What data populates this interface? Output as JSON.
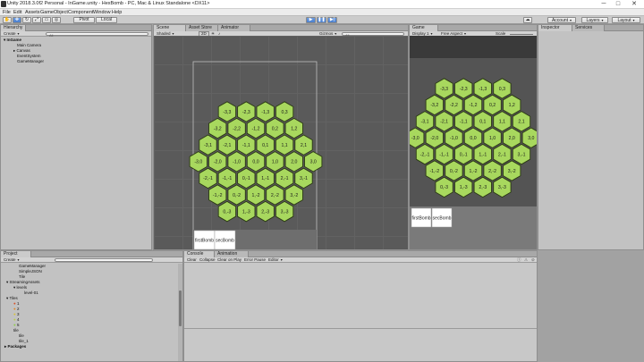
{
  "window": {
    "title": "Unity 2018.3.0f2 Personal - InGame.unity - HexBomb - PC, Mac & Linux Standalone <DX11>",
    "minimize": "─",
    "maximize": "□",
    "close": "✕"
  },
  "menu": [
    "File",
    "Edit",
    "Assets",
    "GameObject",
    "Component",
    "Window",
    "Help"
  ],
  "toolbar": {
    "pivot": "Pivot",
    "local": "Local",
    "account": "Account",
    "layers": "Layers",
    "layout": "Layout"
  },
  "hierarchy": {
    "tab": "Hierarchy",
    "create": "Create",
    "search": "All",
    "scene": "InGame",
    "items": [
      "Main Camera",
      "Canvas",
      "EventSystem",
      "GameManager"
    ]
  },
  "scene_panel": {
    "tabs": [
      "Scene",
      "Asset Store",
      "Animator"
    ],
    "shading": "Shaded",
    "mode": "2D",
    "gizmos": "Gizmos",
    "search": "All"
  },
  "game_panel": {
    "tab": "Game",
    "display": "Display 1",
    "aspect": "Free Aspect",
    "scale": "Scale"
  },
  "inspector": {
    "tabs": [
      "Inspector",
      "Services"
    ]
  },
  "project": {
    "tab": "Project",
    "create": "Create",
    "items": [
      "GameManager",
      "SimpleJSON",
      "Tile",
      "StreamingAssets",
      "levels",
      "level-01",
      "Tiles",
      "1",
      "2",
      "3",
      "4",
      "5",
      "tile",
      "tile",
      "tile_1",
      "Packages"
    ]
  },
  "console": {
    "tabs": [
      "Console",
      "Animation"
    ],
    "buttons": [
      "Clear",
      "Collapse",
      "Clear on Play",
      "Error Pause",
      "Editor"
    ]
  },
  "grid_labels": {
    "row0": [
      "-3,3",
      "-2,3",
      "-1,3",
      "0,3"
    ],
    "row1": [
      "-3,2",
      "-2,2",
      "-1,2",
      "0,2",
      "1,2"
    ],
    "row2": [
      "-3,1",
      "-2,1",
      "-1,1",
      "0,1",
      "1,1",
      "2,1"
    ],
    "row3": [
      "-3,0",
      "-2,0",
      "-1,0",
      "0,0",
      "1,0",
      "2,0",
      "3,0"
    ],
    "row4": [
      "-2,-1",
      "-1,-1",
      "0,-1",
      "1,-1",
      "2,-1",
      "3,-1"
    ],
    "row5": [
      "-1,-2",
      "0,-2",
      "1,-2",
      "2,-2",
      "3,-2"
    ],
    "row6": [
      "0,-3",
      "1,-3",
      "2,-3",
      "3,-3"
    ]
  },
  "bomb_buttons": [
    "firstBomb",
    "secBomb"
  ],
  "colors": {
    "hex_fill": "#a8d85e",
    "hex_stroke": "#2b3a12",
    "selection": "#8fb2e6",
    "play_blue": "#4b7fcc"
  }
}
